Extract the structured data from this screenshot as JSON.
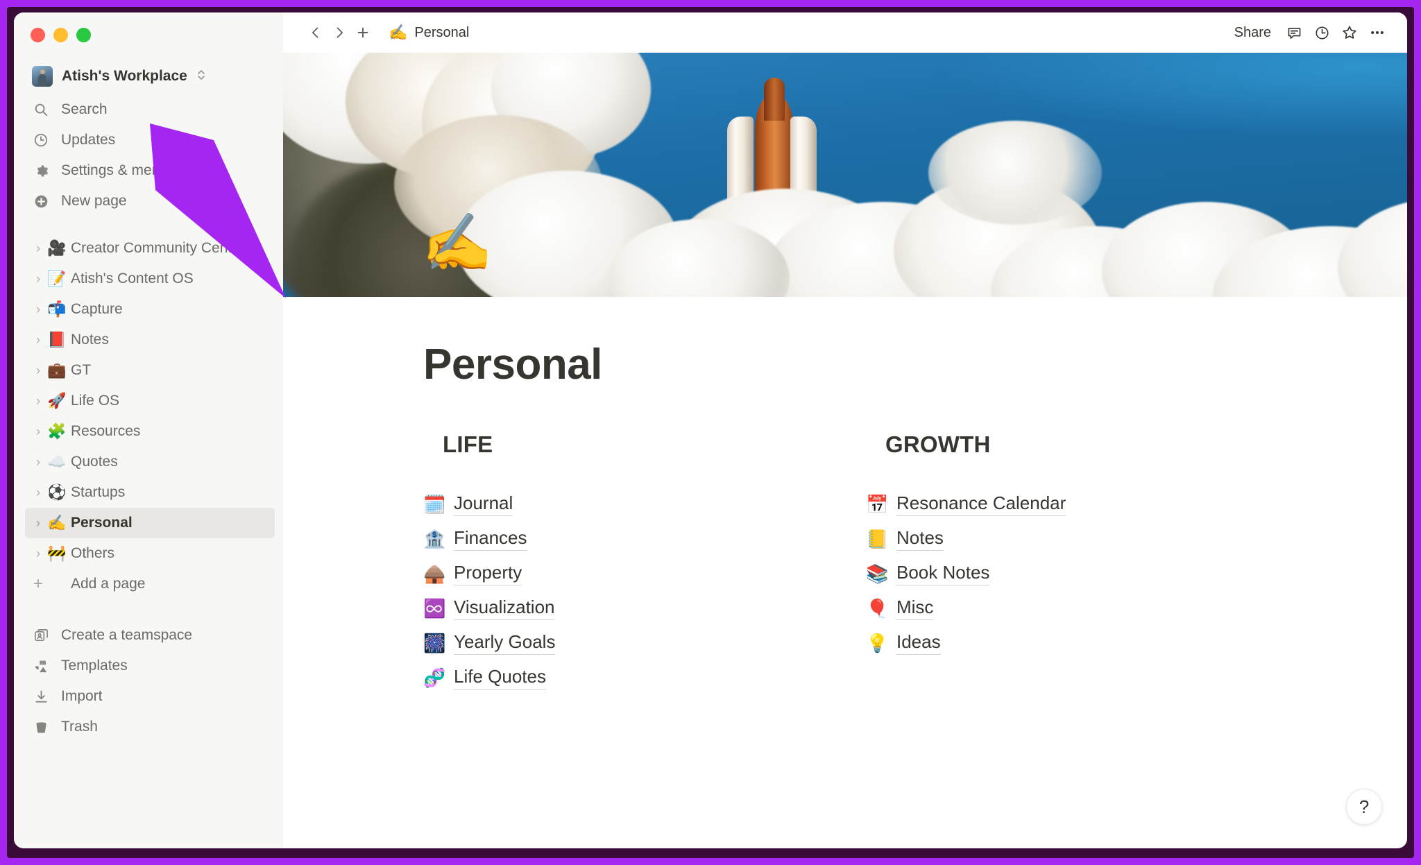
{
  "window": {
    "traffic_lights": [
      "close",
      "minimize",
      "maximize"
    ]
  },
  "sidebar": {
    "workspace": {
      "name": "Atish's Workplace",
      "switcher_icon": "chevron-up-down-icon"
    },
    "nav": [
      {
        "label": "Search",
        "icon": "search-icon"
      },
      {
        "label": "Updates",
        "icon": "clock-icon"
      },
      {
        "label": "Settings & members",
        "icon": "gear-icon"
      },
      {
        "label": "New page",
        "icon": "plus-circle-icon"
      }
    ],
    "pages": [
      {
        "label": "Creator Community Center",
        "emoji": "🎥",
        "active": false
      },
      {
        "label": "Atish's Content OS",
        "emoji": "📝",
        "active": false
      },
      {
        "label": "Capture",
        "emoji": "📬",
        "active": false
      },
      {
        "label": "Notes",
        "emoji": "📕",
        "active": false
      },
      {
        "label": "GT",
        "emoji": "💼",
        "active": false
      },
      {
        "label": "Life OS",
        "emoji": "🚀",
        "active": false
      },
      {
        "label": "Resources",
        "emoji": "🧩",
        "active": false
      },
      {
        "label": "Quotes",
        "emoji": "☁️",
        "active": false
      },
      {
        "label": "Startups",
        "emoji": "⚽",
        "active": false
      },
      {
        "label": "Personal",
        "emoji": "✍️",
        "active": true
      },
      {
        "label": "Others",
        "emoji": "🚧",
        "active": false
      }
    ],
    "add_page": {
      "label": "Add a page",
      "icon": "plus-icon"
    },
    "bottom": [
      {
        "label": "Create a teamspace",
        "icon": "teamspace-icon"
      },
      {
        "label": "Templates",
        "icon": "templates-icon"
      },
      {
        "label": "Import",
        "icon": "import-icon"
      },
      {
        "label": "Trash",
        "icon": "trash-icon"
      }
    ]
  },
  "topbar": {
    "back_icon": "chevron-left-icon",
    "forward_icon": "chevron-right-icon",
    "new_icon": "plus-icon",
    "breadcrumb": {
      "emoji": "✍️",
      "label": "Personal"
    },
    "share_label": "Share",
    "comments_icon": "comment-icon",
    "history_icon": "clock-icon",
    "favorite_icon": "star-icon",
    "more_icon": "ellipsis-icon"
  },
  "page": {
    "cover_alt": "rocket-launch-cover",
    "icon_emoji": "✍️",
    "title": "Personal",
    "columns": [
      {
        "heading": "LIFE",
        "links": [
          {
            "label": "Journal",
            "emoji": "🗓️"
          },
          {
            "label": "Finances",
            "emoji": "🏦"
          },
          {
            "label": "Property",
            "emoji": "🛖"
          },
          {
            "label": "Visualization",
            "emoji": "♾️"
          },
          {
            "label": "Yearly Goals",
            "emoji": "🎆"
          },
          {
            "label": "Life Quotes",
            "emoji": "🧬"
          }
        ]
      },
      {
        "heading": "GROWTH",
        "links": [
          {
            "label": "Resonance Calendar",
            "emoji": "📅"
          },
          {
            "label": "Notes",
            "emoji": "📒"
          },
          {
            "label": "Book Notes",
            "emoji": "📚"
          },
          {
            "label": "Misc",
            "emoji": "🎈"
          },
          {
            "label": "Ideas",
            "emoji": "💡"
          }
        ]
      }
    ]
  },
  "help": {
    "label": "?"
  },
  "annotation": {
    "arrow_color": "#a526f0",
    "points_to": "Settings & members"
  },
  "colors": {
    "frame": "#a526f0",
    "sidebar_bg": "#f7f7f5",
    "active_row": "#e8e7e4",
    "text": "#37352f",
    "muted_text": "#6b6a67"
  }
}
